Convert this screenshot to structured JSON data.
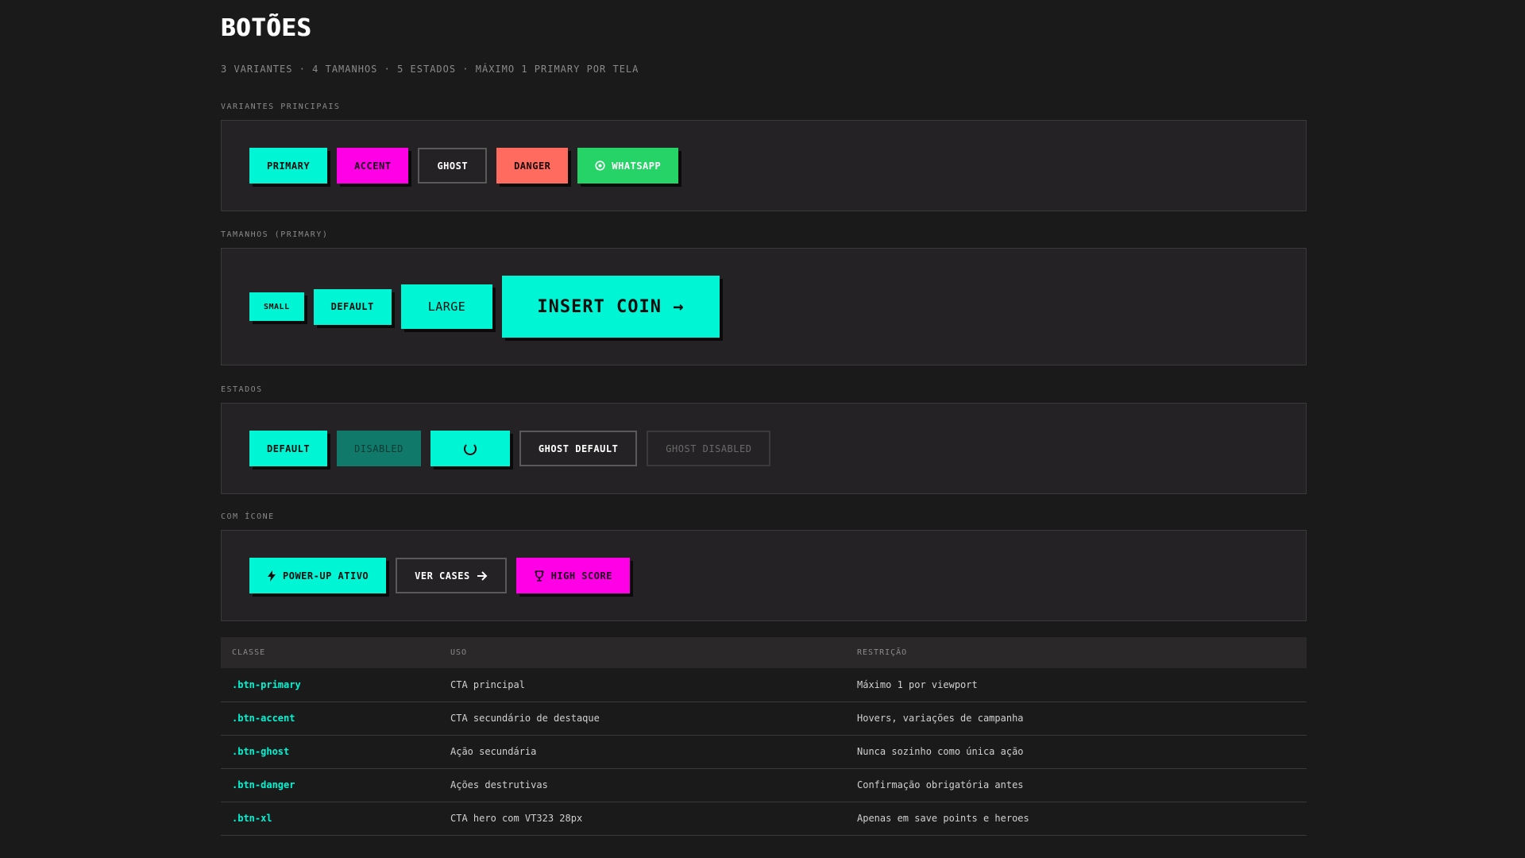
{
  "header": {
    "title": "BOTÕES",
    "subtitle": "3 VARIANTES · 4 TAMANHOS · 5 ESTADOS · MÁXIMO 1 PRIMARY POR TELA"
  },
  "variants": {
    "label": "VARIANTES PRINCIPAIS",
    "primary": "PRIMARY",
    "accent": "ACCENT",
    "ghost": "GHOST",
    "danger": "DANGER",
    "whatsapp": "WHATSAPP"
  },
  "sizes": {
    "label": "TAMANHOS (PRIMARY)",
    "small": "SMALL",
    "default": "DEFAULT",
    "large": "LARGE",
    "xl": "INSERT COIN →"
  },
  "states": {
    "label": "ESTADOS",
    "default": "DEFAULT",
    "disabled": "DISABLED",
    "ghost_default": "GHOST DEFAULT",
    "ghost_disabled": "GHOST DISABLED"
  },
  "with_icon": {
    "label": "COM ÍCONE",
    "power_up": "POWER-UP ATIVO",
    "ver_cases": "VER CASES",
    "high_score": "HIGH SCORE"
  },
  "table": {
    "headers": [
      "CLASSE",
      "USO",
      "RESTRIÇÃO"
    ],
    "rows": [
      [
        ".btn-primary",
        "CTA principal",
        "Máximo 1 por viewport"
      ],
      [
        ".btn-accent",
        "CTA secundário de destaque",
        "Hovers, variações de campanha"
      ],
      [
        ".btn-ghost",
        "Ação secundária",
        "Nunca sozinho como única ação"
      ],
      [
        ".btn-danger",
        "Ações destrutivas",
        "Confirmação obrigatória antes"
      ],
      [
        ".btn-xl",
        "CTA hero com VT323 28px",
        "Apenas em save points e heroes"
      ]
    ]
  },
  "colors": {
    "background": "#1a1a1a",
    "panel": "#242224",
    "primary": "#00f5d4",
    "accent": "#ff00e6",
    "danger": "#ff6b5e",
    "whatsapp": "#25d366"
  },
  "icons": {
    "whatsapp": "whatsapp-icon",
    "power_up": "lightning-icon",
    "ver_cases": "arrow-right-icon",
    "high_score": "trophy-icon",
    "loading": "spinner-icon"
  }
}
